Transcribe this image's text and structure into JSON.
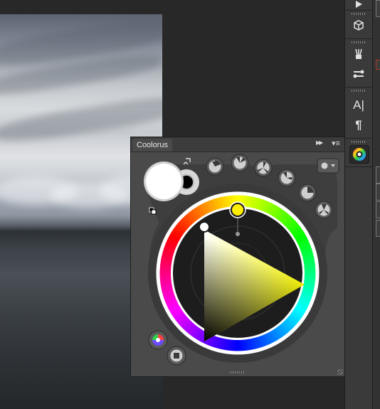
{
  "panel": {
    "title": "Coolorus",
    "collapse_icon": "double-chevron-right-icon",
    "menu_icon": "panel-menu-icon"
  },
  "colors": {
    "foreground": "#ffffff",
    "background": "#000000",
    "hue_selected": "#ffee00",
    "app_background": "#282828",
    "panel_background": "#4a4a4a"
  },
  "toolbar": {
    "icons": [
      "play-icon",
      "3d-box-icon",
      "brush-presets-icon",
      "clone-source-icon",
      "character-icon",
      "paragraph-icon",
      "coolorus-icon"
    ],
    "text_glyphs": {
      "character": "A|",
      "paragraph": "¶"
    }
  },
  "wheel_controls": {
    "icons": [
      "saturation-mode-1-icon",
      "saturation-mode-2-icon",
      "color-scheme-triad-icon",
      "color-scheme-split-icon",
      "color-scheme-quad-icon",
      "color-scheme-off-icon",
      "settings-gear-icon",
      "mixer-icon",
      "stop-icon"
    ]
  }
}
